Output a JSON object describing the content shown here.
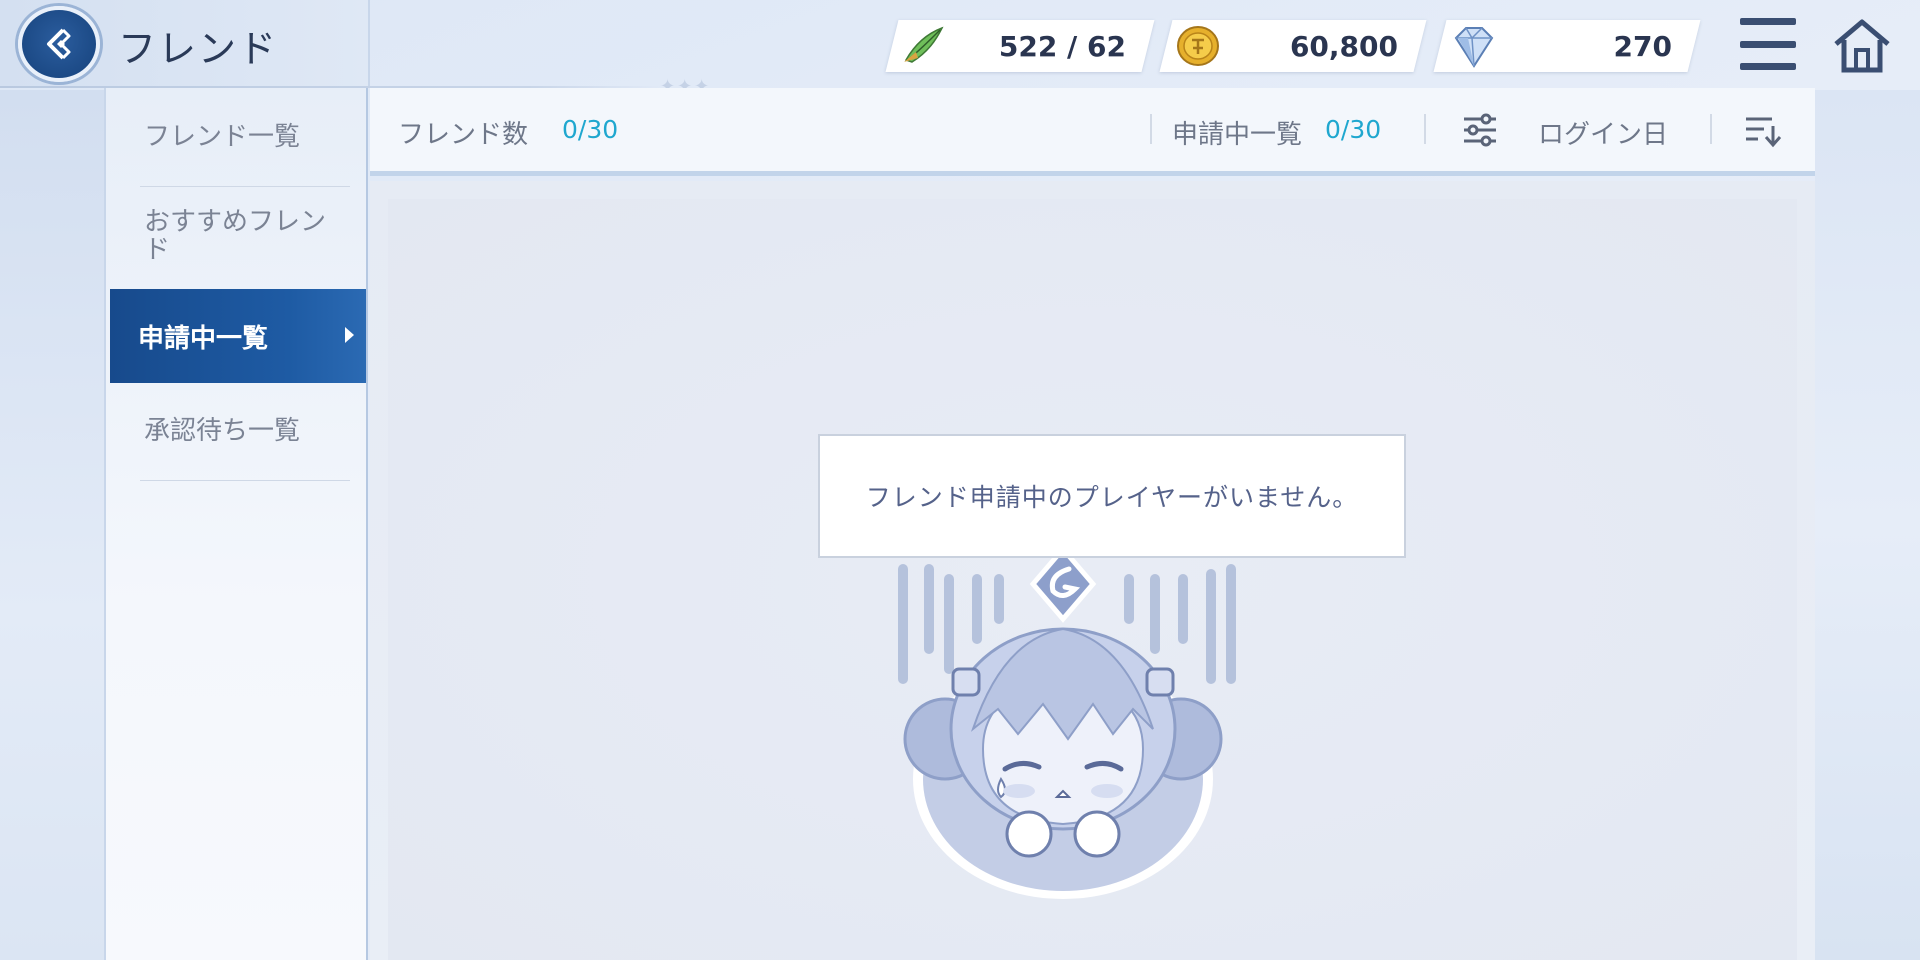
{
  "header": {
    "title": "フレンド",
    "stamina": "522 / 62",
    "coins": "60,800",
    "gems": "270"
  },
  "sidebar": {
    "items": [
      {
        "label": "フレンド一覧"
      },
      {
        "label": "おすすめフレンド"
      },
      {
        "label": "申請中一覧"
      },
      {
        "label": "承認待ち一覧"
      }
    ],
    "active_index": 2
  },
  "toolbar": {
    "friend_count_label": "フレンド数",
    "friend_count_value": "0/30",
    "pending_label": "申請中一覧",
    "pending_value": "0/30",
    "sort_label": "ログイン日"
  },
  "content": {
    "empty_message": "フレンド申請中のプレイヤーがいません。"
  },
  "colors": {
    "accent": "#1e5ba4",
    "count_value": "#1fa7cf",
    "background": "#e3e8f2"
  },
  "icons": [
    "back-icon",
    "stamina-feather-icon",
    "coin-icon",
    "gem-icon",
    "menu-icon",
    "home-icon",
    "filter-icon",
    "sort-icon"
  ]
}
